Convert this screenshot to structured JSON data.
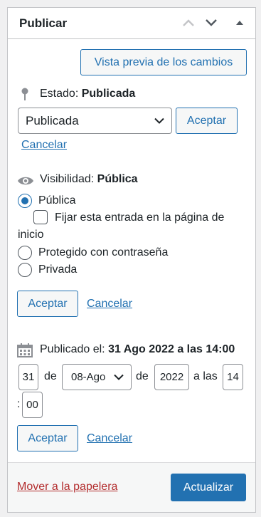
{
  "header": {
    "title": "Publicar"
  },
  "preview_button": "Vista previa de los cambios",
  "status": {
    "label": "Estado:",
    "value": "Publicada",
    "select_value": "Publicada",
    "accept": "Aceptar",
    "cancel": "Cancelar"
  },
  "visibility": {
    "label": "Visibilidad:",
    "value": "Pública",
    "options": {
      "public": "Pública",
      "sticky": "Fijar esta entrada en la página de",
      "sticky_cont": "inicio",
      "password": "Protegido con contraseña",
      "private": "Privada"
    },
    "selected": "public",
    "accept": "Aceptar",
    "cancel": "Cancelar"
  },
  "published": {
    "label": "Publicado el:",
    "value": "31 Ago 2022 a las 14:00",
    "day": "31",
    "de1": "de",
    "month": "08-Ago",
    "de2": "de",
    "year": "2022",
    "at": "a las",
    "hour": "14",
    "colon": ":",
    "minute": "00",
    "accept": "Aceptar",
    "cancel": "Cancelar"
  },
  "footer": {
    "trash": "Mover a la papelera",
    "update": "Actualizar"
  },
  "colors": {
    "accent": "#2271b1",
    "danger": "#b32d2e"
  }
}
